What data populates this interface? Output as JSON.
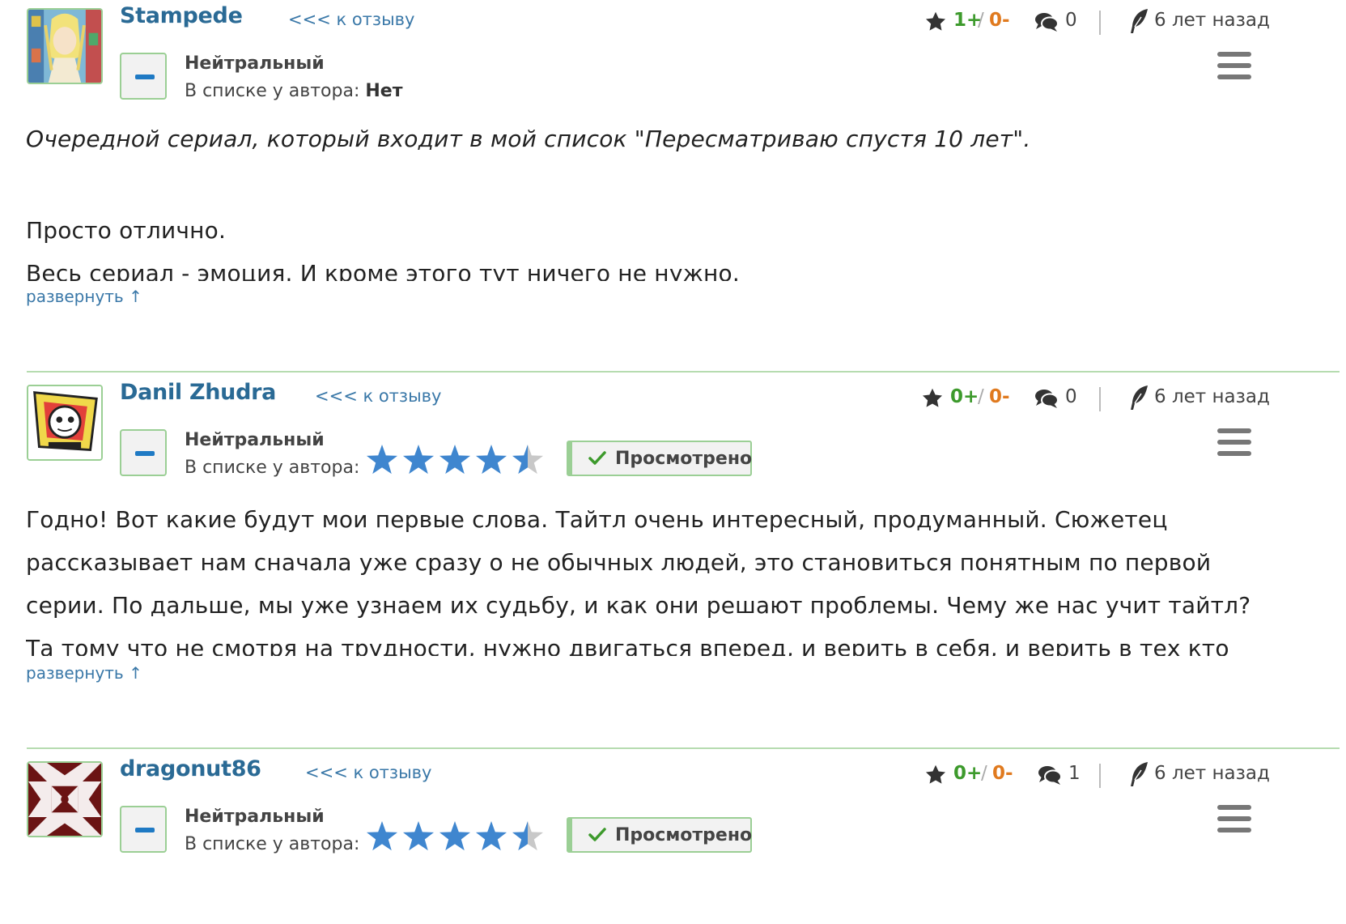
{
  "reviews": [
    {
      "username": "Stampede",
      "back_link": "<<< к отзыву",
      "votes": {
        "plus": "1+",
        "sep": "/",
        "minus": "0-"
      },
      "comments": "0",
      "time": "6 лет назад",
      "status": "Нейтральный",
      "list_label": "В списке у автора:",
      "list_value": "Нет",
      "text": [
        "Очередной сериал, который входит в мой список \"Пересматриваю спустя 10 лет\".",
        "Просто отлично.",
        "Весь сериал - эмоция. И кроме этого тут ничего не нужно."
      ],
      "expand": "развернуть ↑"
    },
    {
      "username": "Danil Zhudra",
      "back_link": "<<< к отзыву",
      "votes": {
        "plus": "0+",
        "sep": "/",
        "minus": "0-"
      },
      "comments": "0",
      "time": "6 лет назад",
      "status": "Нейтральный",
      "list_label": "В списке у автора:",
      "rating": 4.5,
      "watched_label": "Просмотрено",
      "text": [
        "Годно! Вот какие будут мои первые слова. Тайтл очень интересный, продуманный. Сюжетец",
        "рассказывает нам сначала уже сразу о не обычных людей, это становиться понятным по первой",
        "серии. По дальше, мы уже узнаем их судьбу, и как они решают проблемы. Чему же нас учит тайтл?",
        "Та тому что не смотря на трудности, нужно двигаться вперед, и верить в себя, и верить в тех кто"
      ],
      "expand": "развернуть ↑"
    },
    {
      "username": "dragonut86",
      "back_link": "<<< к отзыву",
      "votes": {
        "plus": "0+",
        "sep": "/",
        "minus": "0-"
      },
      "comments": "1",
      "time": "6 лет назад",
      "status": "Нейтральный",
      "list_label": "В списке у автора:",
      "rating": 4.5,
      "watched_label": "Просмотрено"
    }
  ],
  "icons": {
    "rating": "star-icon",
    "comments": "comments-icon",
    "time": "quill-icon",
    "menu": "hamburger-menu-icon",
    "minus": "minus-icon",
    "check": "check-icon"
  },
  "colors": {
    "username": "#2a6a95",
    "link": "#3a78a8",
    "vote_plus": "#3d9a2c",
    "vote_minus": "#e07a1f",
    "star_filled": "#3f86cf",
    "star_empty": "#c8c8c8",
    "accent_border": "#9bcf95"
  }
}
